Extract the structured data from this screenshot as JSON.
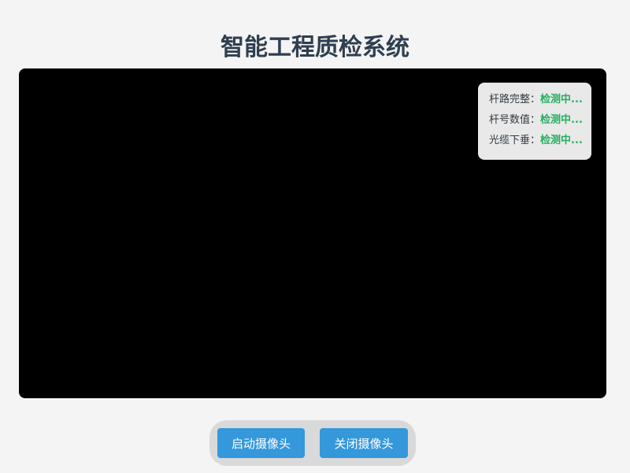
{
  "header": {
    "title": "智能工程质检系统"
  },
  "status_panel": {
    "items": [
      {
        "label": "杆路完整：",
        "value": "检测中..."
      },
      {
        "label": "杆号数值：",
        "value": "检测中..."
      },
      {
        "label": "光缆下垂：",
        "value": "检测中..."
      }
    ]
  },
  "controls": {
    "start_label": "启动摄像头",
    "stop_label": "关闭摄像头"
  },
  "colors": {
    "status_value": "#27ae60",
    "button": "#3498db",
    "title": "#2f3e50",
    "video_bg": "#000000"
  }
}
